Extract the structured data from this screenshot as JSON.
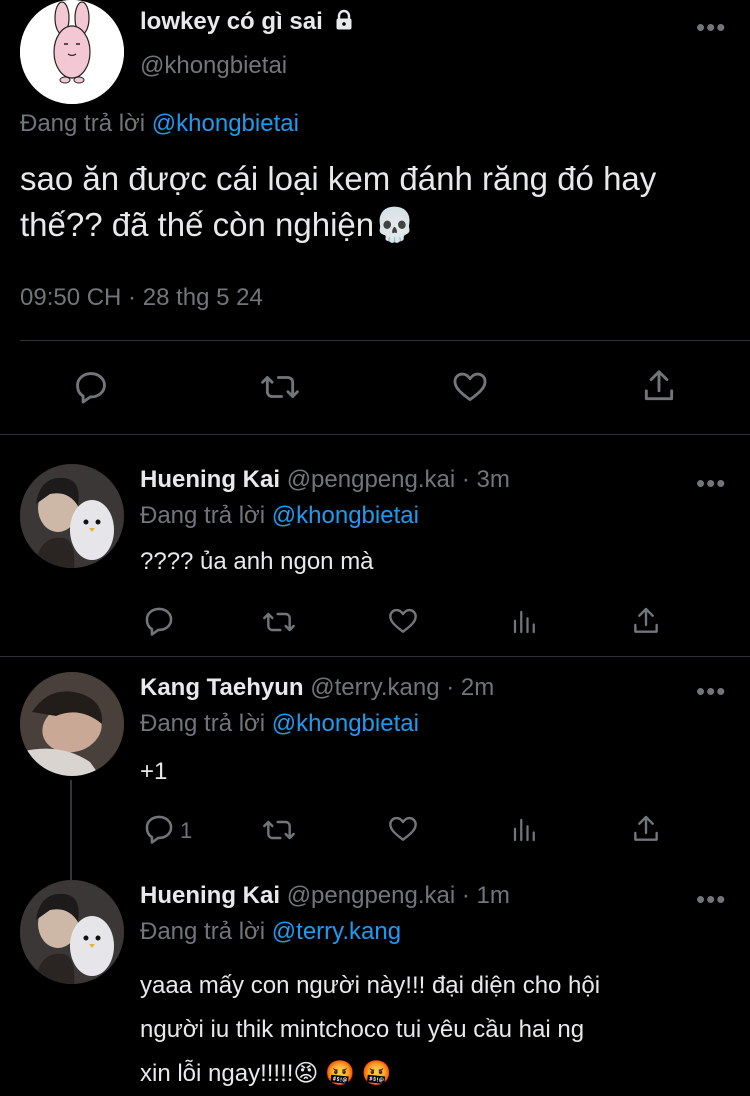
{
  "main_tweet": {
    "display_name": "lowkey có gì sai",
    "handle": "@khongbietai",
    "replying_prefix": "Đang trả lời",
    "replying_to": "@khongbietai",
    "text_line1": "sao ăn được cái loại kem đánh răng đó hay",
    "text_line2": "thế?? đã thế còn nghiện",
    "emoji": "💀",
    "timestamp": "09:50 CH · 28 thg 5 24",
    "actions": [
      "reply-icon",
      "retweet-icon",
      "like-icon",
      "share-icon"
    ]
  },
  "replies": [
    {
      "display_name": "Huening Kai",
      "handle": "@pengpeng.kai",
      "time": "· 3m",
      "replying_prefix": "Đang trả lời",
      "replying_to": "@khongbietai",
      "text": "???? ủa anh ngon mà",
      "reply_count": ""
    },
    {
      "display_name": "Kang Taehyun",
      "handle": "@terry.kang",
      "time": "· 2m",
      "replying_prefix": "Đang trả lời",
      "replying_to": "@khongbietai",
      "text": "+1",
      "reply_count": "1"
    },
    {
      "display_name": "Huening Kai",
      "handle": "@pengpeng.kai",
      "time": "· 1m",
      "replying_prefix": "Đang trả lời",
      "replying_to": "@terry.kang",
      "text_line1": "yaaa mấy con người này!!! đại diện cho hội",
      "text_line2": "người iu thik mintchoco tui yêu cầu hai ng",
      "text_line3": "xin lỗi ngay!!!!!",
      "emojis": "😡 🤬 🤬"
    }
  ],
  "colors": {
    "background": "#000000",
    "text": "#e7e9ea",
    "muted": "#71767b",
    "link": "#1d9bf0",
    "divider": "#2f3336"
  }
}
